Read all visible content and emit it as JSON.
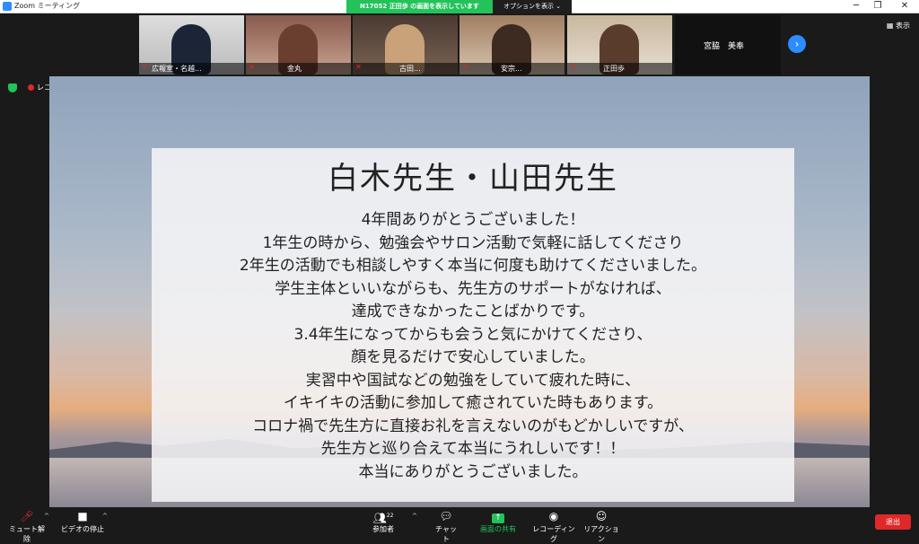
{
  "window": {
    "title": "Zoom ミーティング"
  },
  "share": {
    "banner": "N17052  正田歩 の画面を表示しています",
    "options": "オプションを表示 ⌄"
  },
  "participants": [
    {
      "name": "広報室・名越...",
      "muted": true
    },
    {
      "name": "金丸",
      "muted": true
    },
    {
      "name": "古田...",
      "muted": true
    },
    {
      "name": "安宗...",
      "muted": true
    },
    {
      "name": "正田歩",
      "muted": true
    }
  ],
  "name_tile": {
    "name": "宮脇　美奉"
  },
  "view_label": "表示",
  "recording_label": "レコーディング中",
  "slide": {
    "title": "白木先生・山田先生",
    "lines": [
      "4年間ありがとうございました！",
      "1年生の時から、勉強会やサロン活動で気軽に話してくださり",
      "2年生の活動でも相談しやすく本当に何度も助けてくださいました。",
      "学生主体といいながらも、先生方のサポートがなければ、",
      "達成できなかったことばかりです。",
      "3.4年生になってからも会うと気にかけてくださり、",
      "顔を見るだけで安心していました。",
      "実習中や国試などの勉強をしていて疲れた時に、",
      "イキイキの活動に参加して癒されていた時もあります。",
      "コロナ禍で先生方に直接お礼を言えないのがもどかしいですが、",
      "先生方と巡り合えて本当にうれしいです！！",
      "本当にありがとうございました。"
    ]
  },
  "controls": {
    "mute": "ミュート解除",
    "video": "ビデオの停止",
    "participants": "参加者",
    "participants_count": "22",
    "chat": "チャット",
    "share": "画面の共有",
    "record": "レコーディング",
    "reaction": "リアクション",
    "leave": "退出"
  },
  "colors": {
    "accent": "#2d8cff",
    "share_green": "#23c25b",
    "leave_red": "#e02828"
  }
}
